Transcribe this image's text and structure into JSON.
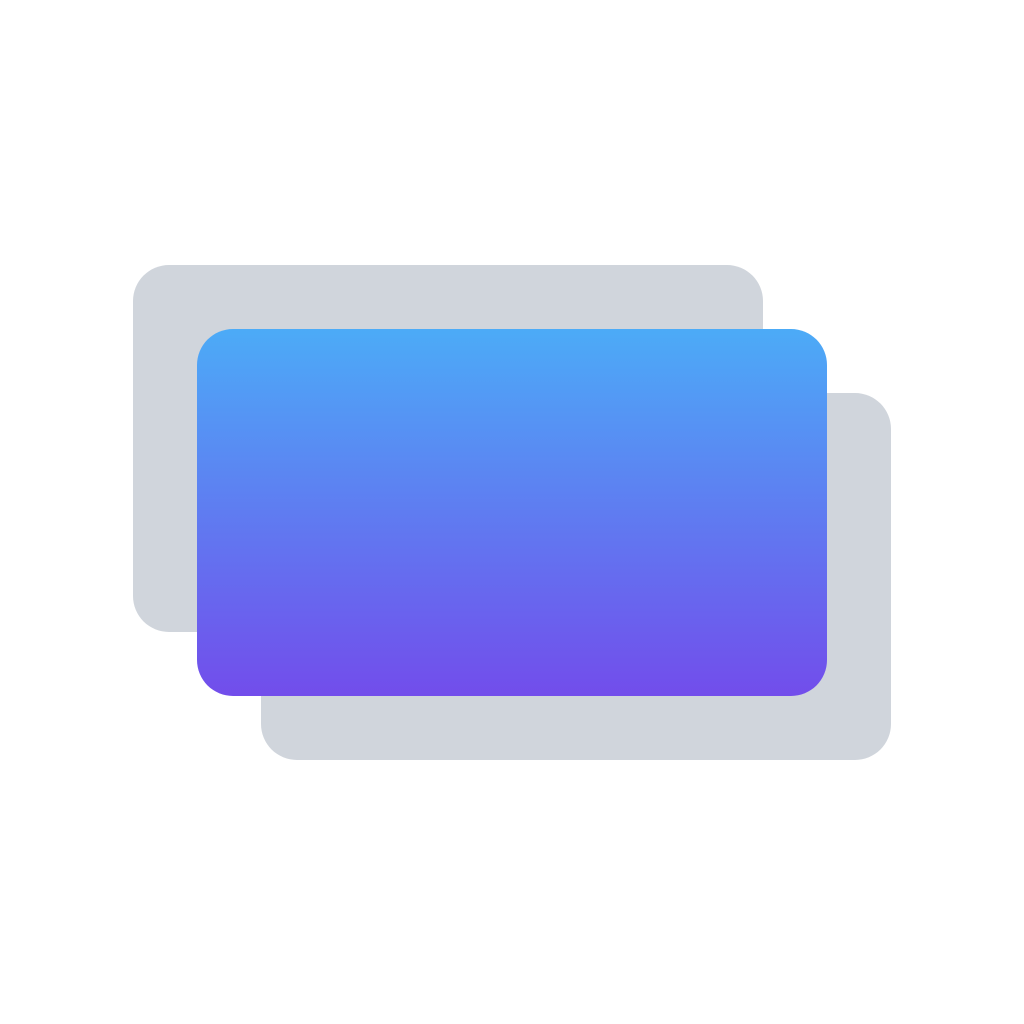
{
  "colors": {
    "background": "#ffffff",
    "stack_card": "#d0d5dc",
    "front_gradient_top": "#4cabf7",
    "front_gradient_bottom": "#724deb"
  },
  "icon": {
    "name": "stacked-cards-icon",
    "layers": [
      {
        "role": "back-card-top-left"
      },
      {
        "role": "back-card-bottom-right"
      },
      {
        "role": "front-card"
      }
    ]
  }
}
